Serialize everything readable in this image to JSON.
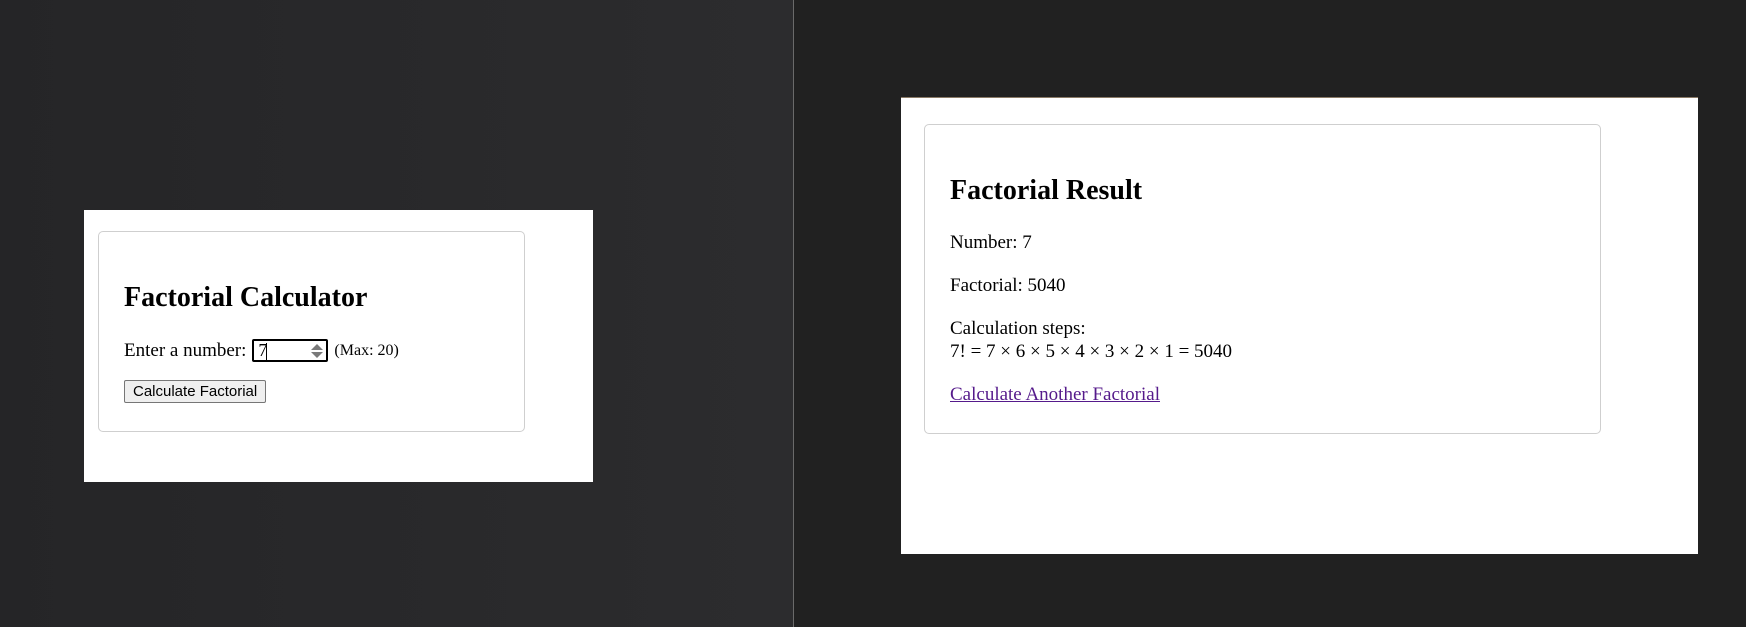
{
  "left_page": {
    "title": "Factorial Calculator",
    "input_label": "Enter a number:",
    "input_value": "7",
    "max_hint": "(Max: 20)",
    "button_label": "Calculate Factorial"
  },
  "right_page": {
    "title": "Factorial Result",
    "number_line": "Number: 7",
    "factorial_line": "Factorial: 5040",
    "steps_label": "Calculation steps:",
    "steps_expression": "7! = 7 × 6 × 5 × 4 × 3 × 2 × 1 = 5040",
    "link_label": "Calculate Another Factorial",
    "link_color": "#551a8b"
  }
}
